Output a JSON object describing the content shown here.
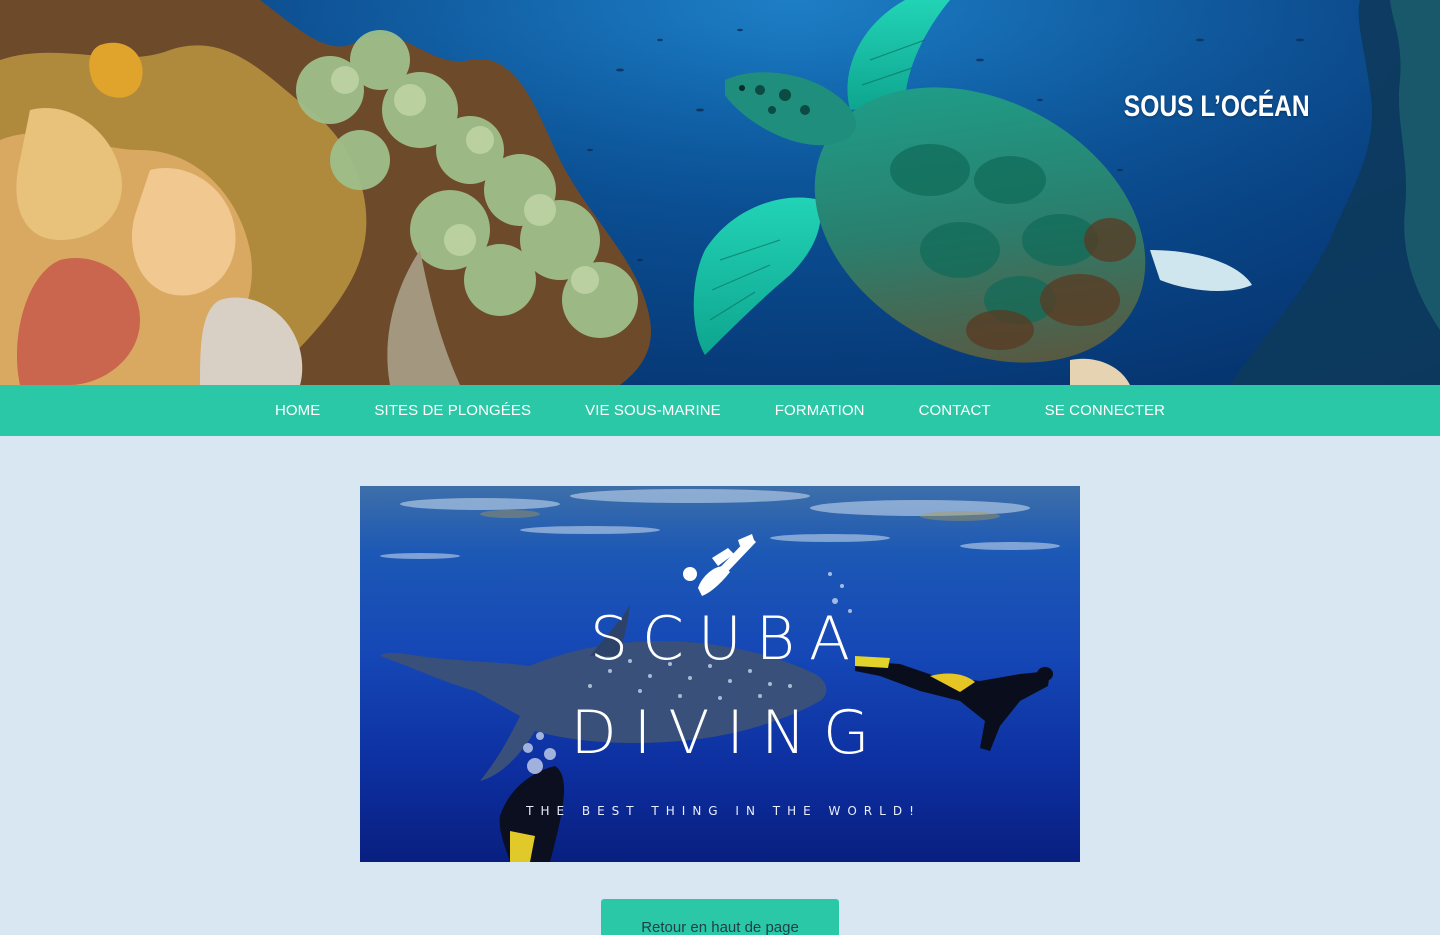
{
  "site": {
    "title": "SOUS L’OCÉAN"
  },
  "nav": {
    "items": [
      {
        "label": "HOME"
      },
      {
        "label": "SITES DE PLONGÉES"
      },
      {
        "label": "VIE SOUS-MARINE"
      },
      {
        "label": "FORMATION"
      },
      {
        "label": "CONTACT"
      },
      {
        "label": "SE CONNECTER"
      }
    ]
  },
  "banner": {
    "line1": "SCUBA",
    "line2": "DIVING",
    "tagline": "THE BEST THING IN THE WORLD!"
  },
  "footer": {
    "back_to_top": "Retour en haut de page"
  },
  "colors": {
    "accent": "#2bc8a7",
    "page_background": "#d9e7f3",
    "text_white": "#ffffff"
  }
}
